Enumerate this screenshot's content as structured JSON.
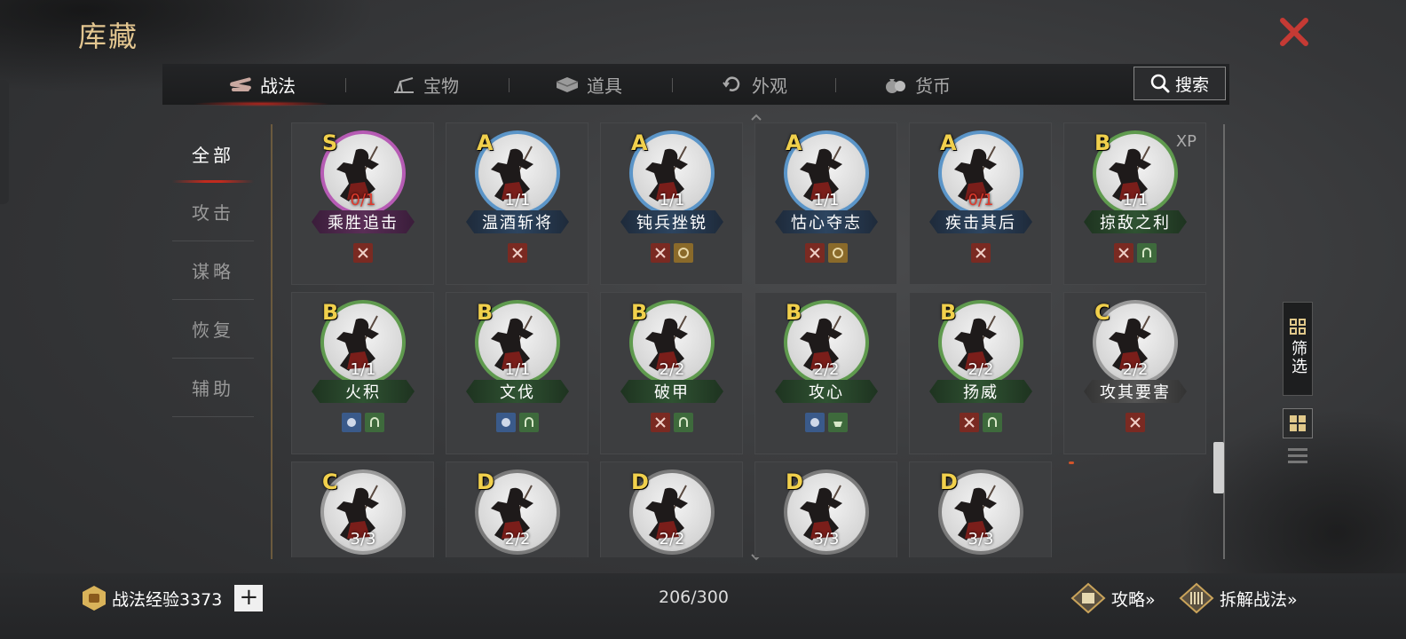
{
  "window": {
    "title": "库藏"
  },
  "tabs": [
    {
      "label": "战法",
      "icon": "bundle-icon",
      "active": true
    },
    {
      "label": "宝物",
      "icon": "treasure-icon",
      "active": false
    },
    {
      "label": "道具",
      "icon": "item-box-icon",
      "active": false
    },
    {
      "label": "外观",
      "icon": "refresh-icon",
      "active": false
    },
    {
      "label": "货币",
      "icon": "money-bag-icon",
      "active": false
    }
  ],
  "search": {
    "label": "搜索",
    "icon": "search-icon"
  },
  "sidebar": {
    "items": [
      {
        "label": "全部",
        "active": true
      },
      {
        "label": "攻击",
        "active": false
      },
      {
        "label": "谋略",
        "active": false
      },
      {
        "label": "恢复",
        "active": false
      },
      {
        "label": "辅助",
        "active": false
      }
    ]
  },
  "skills": [
    {
      "grade": "S",
      "count": "0/1",
      "zero": true,
      "name": "乘胜追击",
      "tags": [
        "sword"
      ]
    },
    {
      "grade": "A",
      "count": "1/1",
      "zero": false,
      "name": "温酒斩将",
      "tags": [
        "sword"
      ]
    },
    {
      "grade": "A",
      "count": "1/1",
      "zero": false,
      "name": "钝兵挫锐",
      "tags": [
        "sword",
        "beast"
      ]
    },
    {
      "grade": "A",
      "count": "1/1",
      "zero": false,
      "name": "怙心夺志",
      "tags": [
        "sword",
        "beast"
      ]
    },
    {
      "grade": "A",
      "count": "0/1",
      "zero": true,
      "name": "疾击其后",
      "tags": [
        "sword"
      ]
    },
    {
      "grade": "B",
      "count": "1/1",
      "zero": false,
      "name": "掠敌之利",
      "tags": [
        "sword",
        "helm"
      ],
      "xp": "XP"
    },
    {
      "grade": "B",
      "count": "1/1",
      "zero": false,
      "name": "火积",
      "tags": [
        "scroll",
        "helm"
      ]
    },
    {
      "grade": "B",
      "count": "1/1",
      "zero": false,
      "name": "文伐",
      "tags": [
        "scroll",
        "helm"
      ]
    },
    {
      "grade": "B",
      "count": "2/2",
      "zero": false,
      "name": "破甲",
      "tags": [
        "sword",
        "helm"
      ]
    },
    {
      "grade": "B",
      "count": "2/2",
      "zero": false,
      "name": "攻心",
      "tags": [
        "scroll",
        "pot"
      ]
    },
    {
      "grade": "B",
      "count": "2/2",
      "zero": false,
      "name": "扬威",
      "tags": [
        "sword",
        "helm"
      ]
    },
    {
      "grade": "C",
      "count": "2/2",
      "zero": false,
      "name": "攻其要害",
      "tags": [
        "sword"
      ]
    },
    {
      "grade": "C",
      "count": "3/3",
      "zero": false,
      "name": "",
      "tags": []
    },
    {
      "grade": "D",
      "count": "2/2",
      "zero": false,
      "name": "",
      "tags": []
    },
    {
      "grade": "D",
      "count": "2/2",
      "zero": false,
      "name": "",
      "tags": []
    },
    {
      "grade": "D",
      "count": "3/3",
      "zero": false,
      "name": "",
      "tags": []
    },
    {
      "grade": "D",
      "count": "3/3",
      "zero": false,
      "name": "",
      "tags": []
    }
  ],
  "filter": {
    "label": "筛选"
  },
  "bottom": {
    "exp_label": "战法经验3373",
    "plus": "+",
    "page_count": "206/300",
    "guide_label": "攻略»",
    "dismantle_label": "拆解战法»"
  },
  "colors": {
    "title_gold": "#e3c690",
    "close_red": "#c53a34",
    "grade_yellow": "#f1d04c",
    "zero_red": "#e03a2c",
    "ring_S": "#b65bb4",
    "ring_A": "#5b95c8",
    "ring_B": "#5f9a4e",
    "ring_C": "#9a9a9a"
  }
}
